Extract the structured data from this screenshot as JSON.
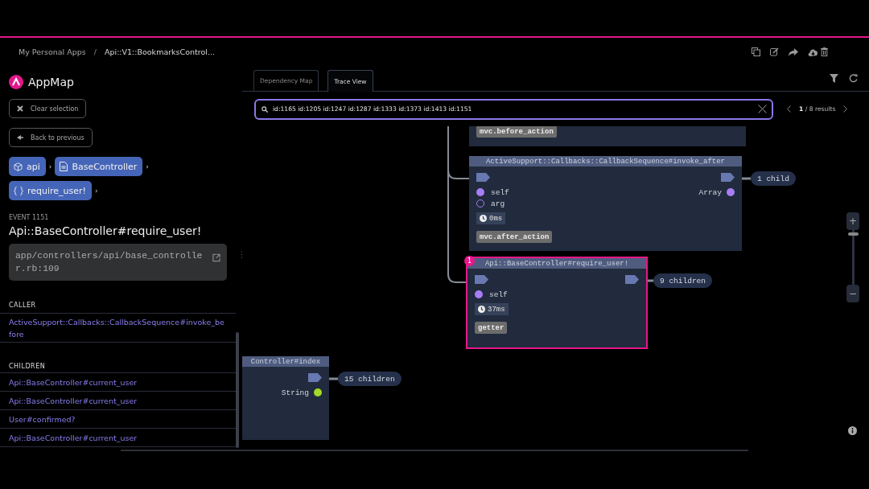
{
  "breadcrumb": {
    "items": [
      "My Personal Apps",
      "Api::V1::BookmarksControl..."
    ],
    "separator": "/"
  },
  "sidebar": {
    "logo": "AppMap",
    "buttons": [
      {
        "label": "Clear selection",
        "kind": "clear"
      },
      {
        "label": "Back to previous",
        "kind": "back"
      }
    ],
    "path_separator": "›",
    "path": [
      {
        "label": "api",
        "kind": "package"
      },
      {
        "label": "BaseController",
        "kind": "class"
      },
      {
        "label": "require_user!",
        "kind": "function"
      }
    ],
    "event_label": "EVENT 1151",
    "event_title": "Api::BaseController#require_user!",
    "location": "app/controllers/api/base_controller.rb:109",
    "caller_heading": "CALLER",
    "caller": [
      "ActiveSupport::Callbacks::CallbackSequence#invoke_before"
    ],
    "children_heading": "CHILDREN",
    "children": [
      "Api::BaseController#current_user",
      "Api::BaseController#current_user",
      "User#confirmed?",
      "Api::BaseController#current_user"
    ]
  },
  "tabs": [
    {
      "label": "Dependency Map",
      "selected": false
    },
    {
      "label": "Trace View",
      "selected": true
    }
  ],
  "search": {
    "value": "id:1165 id:1205 id:1247 id:1287 id:1333 id:1373 id:1413 id:1151",
    "results": "**1** / 8 results"
  },
  "nodes": [
    {
      "labels": [
        "mvc.before_action"
      ],
      "input_port": false,
      "output_port": false,
      "selected": false
    },
    {
      "title": "ActiveSupport::Callbacks::CallbackSequence#invoke_after",
      "input_port": true,
      "output_port": true,
      "params": [
        {
          "name": "self",
          "filled": true
        },
        {
          "name": "arg",
          "filled": false
        }
      ],
      "outputs": [
        {
          "type": "Array",
          "color": "#a77ef5"
        }
      ],
      "elapsed": "0ms",
      "labels": [
        "mvc.after_action"
      ],
      "children": "1 child",
      "selected": false
    },
    {
      "title": "Api::BaseController#require_user!",
      "badge": "1",
      "input_port": true,
      "output_port": true,
      "params": [
        {
          "name": "self",
          "filled": true
        }
      ],
      "elapsed": "37ms",
      "labels": [
        "getter"
      ],
      "children": "9 children",
      "selected": true
    },
    {
      "title": "Controller#index",
      "input_port": false,
      "output_port": true,
      "outputs": [
        {
          "type": "String",
          "color": "#a3d929"
        }
      ],
      "children": "15 children",
      "selected": false
    }
  ],
  "zoom": {
    "level": 0.95,
    "in_label": "+",
    "out_label": "−"
  }
}
